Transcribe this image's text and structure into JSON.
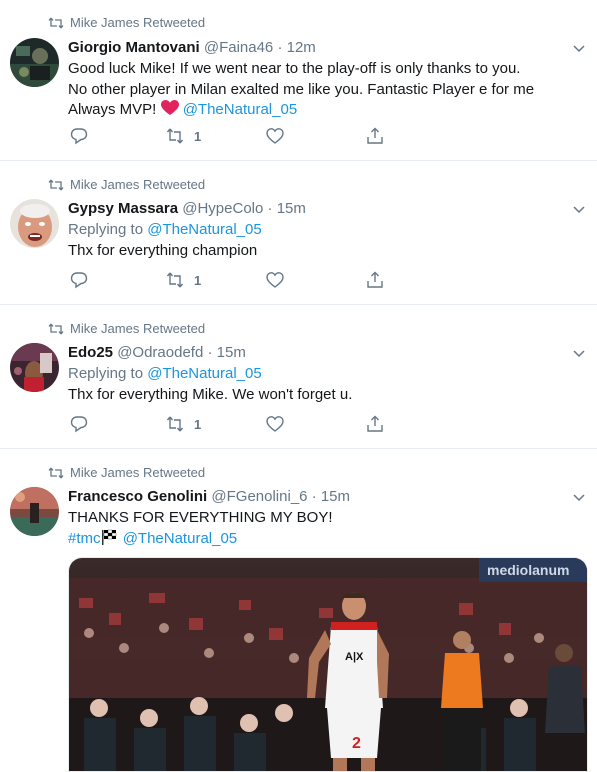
{
  "tweets": [
    {
      "retweeted_by": "Mike James Retweeted",
      "name": "Giorgio Mantovani",
      "handle": "@Faina46",
      "time": "12m",
      "text_line1": "Good luck Mike! If we went near to the play-off is only thanks to you.",
      "text_line2": "No other player in Milan exalted me like you. Fantastic Player e for me",
      "text_line3_pre": "Always MVP!",
      "mention": "@TheNatural_05",
      "retweet_count": "1"
    },
    {
      "retweeted_by": "Mike James Retweeted",
      "name": "Gypsy Massara",
      "handle": "@HypeColo",
      "time": "15m",
      "replying_label": "Replying to",
      "replying_to": "@TheNatural_05",
      "text": "Thx for everything champion",
      "retweet_count": "1"
    },
    {
      "retweeted_by": "Mike James Retweeted",
      "name": "Edo25",
      "handle": "@Odraodefd",
      "time": "15m",
      "replying_label": "Replying to",
      "replying_to": "@TheNatural_05",
      "text": "Thx for everything Mike. We won't forget u.",
      "retweet_count": "1"
    },
    {
      "retweeted_by": "Mike James Retweeted",
      "name": "Francesco Genolini",
      "handle": "@FGenolini_6",
      "time": "15m",
      "text": "THANKS FOR EVERYTHING MY BOY!",
      "hashtag": "#tmc",
      "mention": "@TheNatural_05",
      "media_banner": "mediolanum",
      "jersey_text": "A|X",
      "jersey_number": "2"
    }
  ],
  "separator": "·",
  "colors": {
    "link": "#1b95e0",
    "secondary": "#657786",
    "heart": "#e0245e",
    "divider": "#e6ecf0"
  },
  "icons": [
    "retweet-icon",
    "chevron-down-icon",
    "reply-icon",
    "like-icon",
    "share-icon",
    "red-heart-icon",
    "checkered-flag-icon"
  ]
}
